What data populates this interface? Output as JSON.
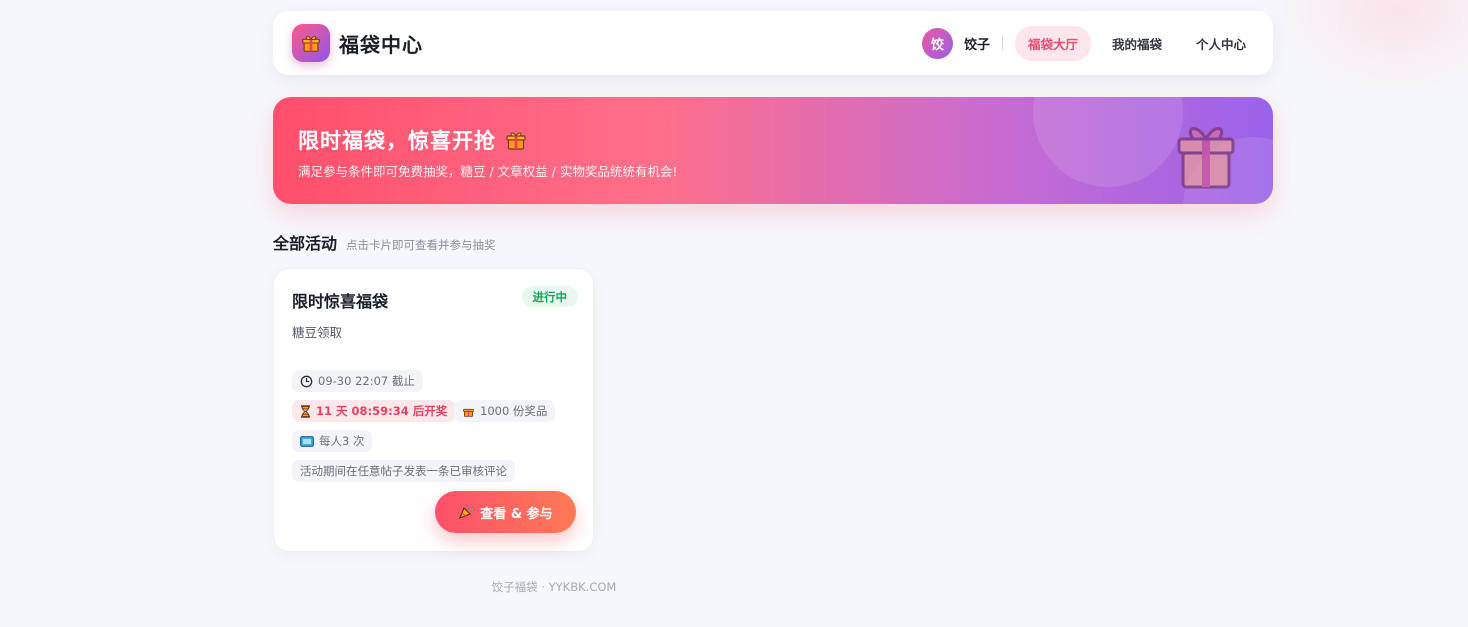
{
  "header": {
    "brand": "福袋中心",
    "logo_icon": "gift-icon",
    "user": {
      "avatar_text": "饺",
      "name": "饺子"
    },
    "nav": [
      {
        "label": "福袋大厅",
        "active": true
      },
      {
        "label": "我的福袋",
        "active": false
      },
      {
        "label": "个人中心",
        "active": false
      }
    ]
  },
  "banner": {
    "title": "限时福袋，惊喜开抢",
    "subtitle": "满足参与条件即可免费抽奖，糖豆 / 文章权益 / 实物奖品统统有机会!",
    "icon": "gift-box-icon"
  },
  "section": {
    "title": "全部活动",
    "hint": "点击卡片即可查看并参与抽奖"
  },
  "activities": [
    {
      "title": "限时惊喜福袋",
      "status": "进行中",
      "description": "糖豆领取",
      "deadline": "09-30 22:07 截止",
      "countdown": "11 天 08:59:34 后开奖",
      "prizes": "1000 份奖品",
      "per_user": "每人3 次",
      "condition": "活动期间在任意帖子发表一条已审核评论",
      "cta": "查看 & 参与"
    }
  ],
  "footer": {
    "text": "饺子福袋 · YYKBK.COM"
  },
  "colors": {
    "accent": "#ff4f6c",
    "purple": "#9b62ea",
    "status_green": "#17a35a",
    "countdown_red": "#e8415e"
  }
}
